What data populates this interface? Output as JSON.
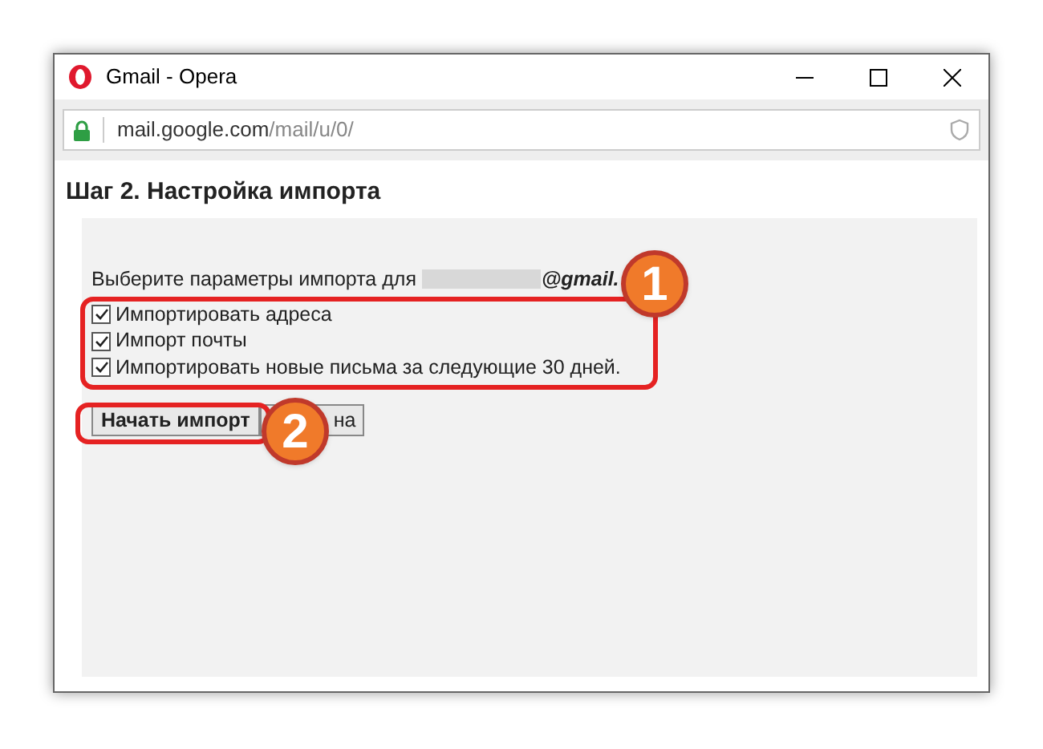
{
  "window": {
    "title": "Gmail - Opera"
  },
  "address_bar": {
    "host": "mail.google.com",
    "path": "/mail/u/0/"
  },
  "heading": "Шаг 2. Настройка импорта",
  "prompt": {
    "text": "Выберите параметры импорта для",
    "email_suffix": "@gmail."
  },
  "options": [
    {
      "label": "Импортировать адреса",
      "checked": true
    },
    {
      "label": "Импорт почты",
      "checked": true
    },
    {
      "label": "Импортировать новые письма за следующие 30 дней.",
      "checked": true
    }
  ],
  "buttons": [
    {
      "label": "Начать импорт"
    },
    {
      "label": "на"
    }
  ],
  "callouts": [
    "1",
    "2"
  ]
}
